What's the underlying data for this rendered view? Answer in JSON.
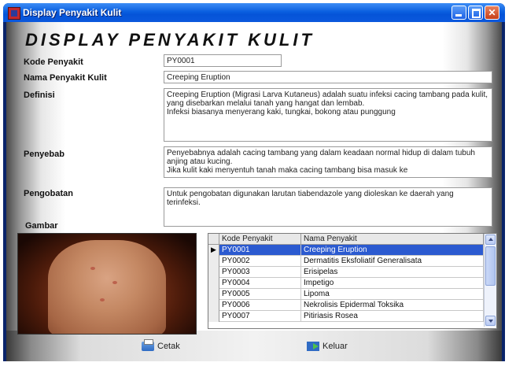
{
  "window": {
    "title": "Display Penyakit Kulit"
  },
  "form": {
    "heading": "DISPLAY PENYAKIT KULIT",
    "kode_label": "Kode Penyakit",
    "kode_value": "PY0001",
    "nama_label": "Nama Penyakit Kulit",
    "nama_value": "Creeping Eruption",
    "definisi_label": "Definisi",
    "definisi_value": "Creeping Eruption (Migrasi Larva Kutaneus) adalah suatu infeksi cacing tambang pada kulit, yang disebarkan melalui tanah yang hangat dan lembab.\nInfeksi biasanya menyerang kaki, tungkai, bokong atau punggung",
    "penyebab_label": "Penyebab",
    "penyebab_value": "Penyebabnya adalah cacing tambang yang dalam keadaan normal hidup di dalam tubuh anjing atau kucing.\nJika kulit kaki menyentuh tanah maka cacing tambang bisa masuk ke",
    "pengobatan_label": "Pengobatan",
    "pengobatan_value": "Untuk pengobatan digunakan larutan tiabendazole yang dioleskan ke daerah yang terinfeksi.",
    "gambar_label": "Gambar"
  },
  "grid": {
    "headers": [
      "Kode Penyakit",
      "Nama Penyakit"
    ],
    "rows": [
      {
        "kode": "PY0001",
        "nama": "Creeping Eruption",
        "selected": true
      },
      {
        "kode": "PY0002",
        "nama": "Dermatitis Eksfoliatif Generalisata"
      },
      {
        "kode": "PY0003",
        "nama": "Erisipelas"
      },
      {
        "kode": "PY0004",
        "nama": "Impetigo"
      },
      {
        "kode": "PY0005",
        "nama": "Lipoma"
      },
      {
        "kode": "PY0006",
        "nama": "Nekrolisis Epidermal Toksika"
      },
      {
        "kode": "PY0007",
        "nama": "Pitiriasis Rosea"
      }
    ],
    "current_row_marker": "▶"
  },
  "buttons": {
    "cetak": "Cetak",
    "keluar": "Keluar"
  },
  "icons": {
    "app": "app-icon",
    "print": "printer-icon",
    "exit": "exit-door-icon"
  },
  "colors": {
    "titlebar": "#0554d8",
    "selection": "#2b5ad0"
  }
}
